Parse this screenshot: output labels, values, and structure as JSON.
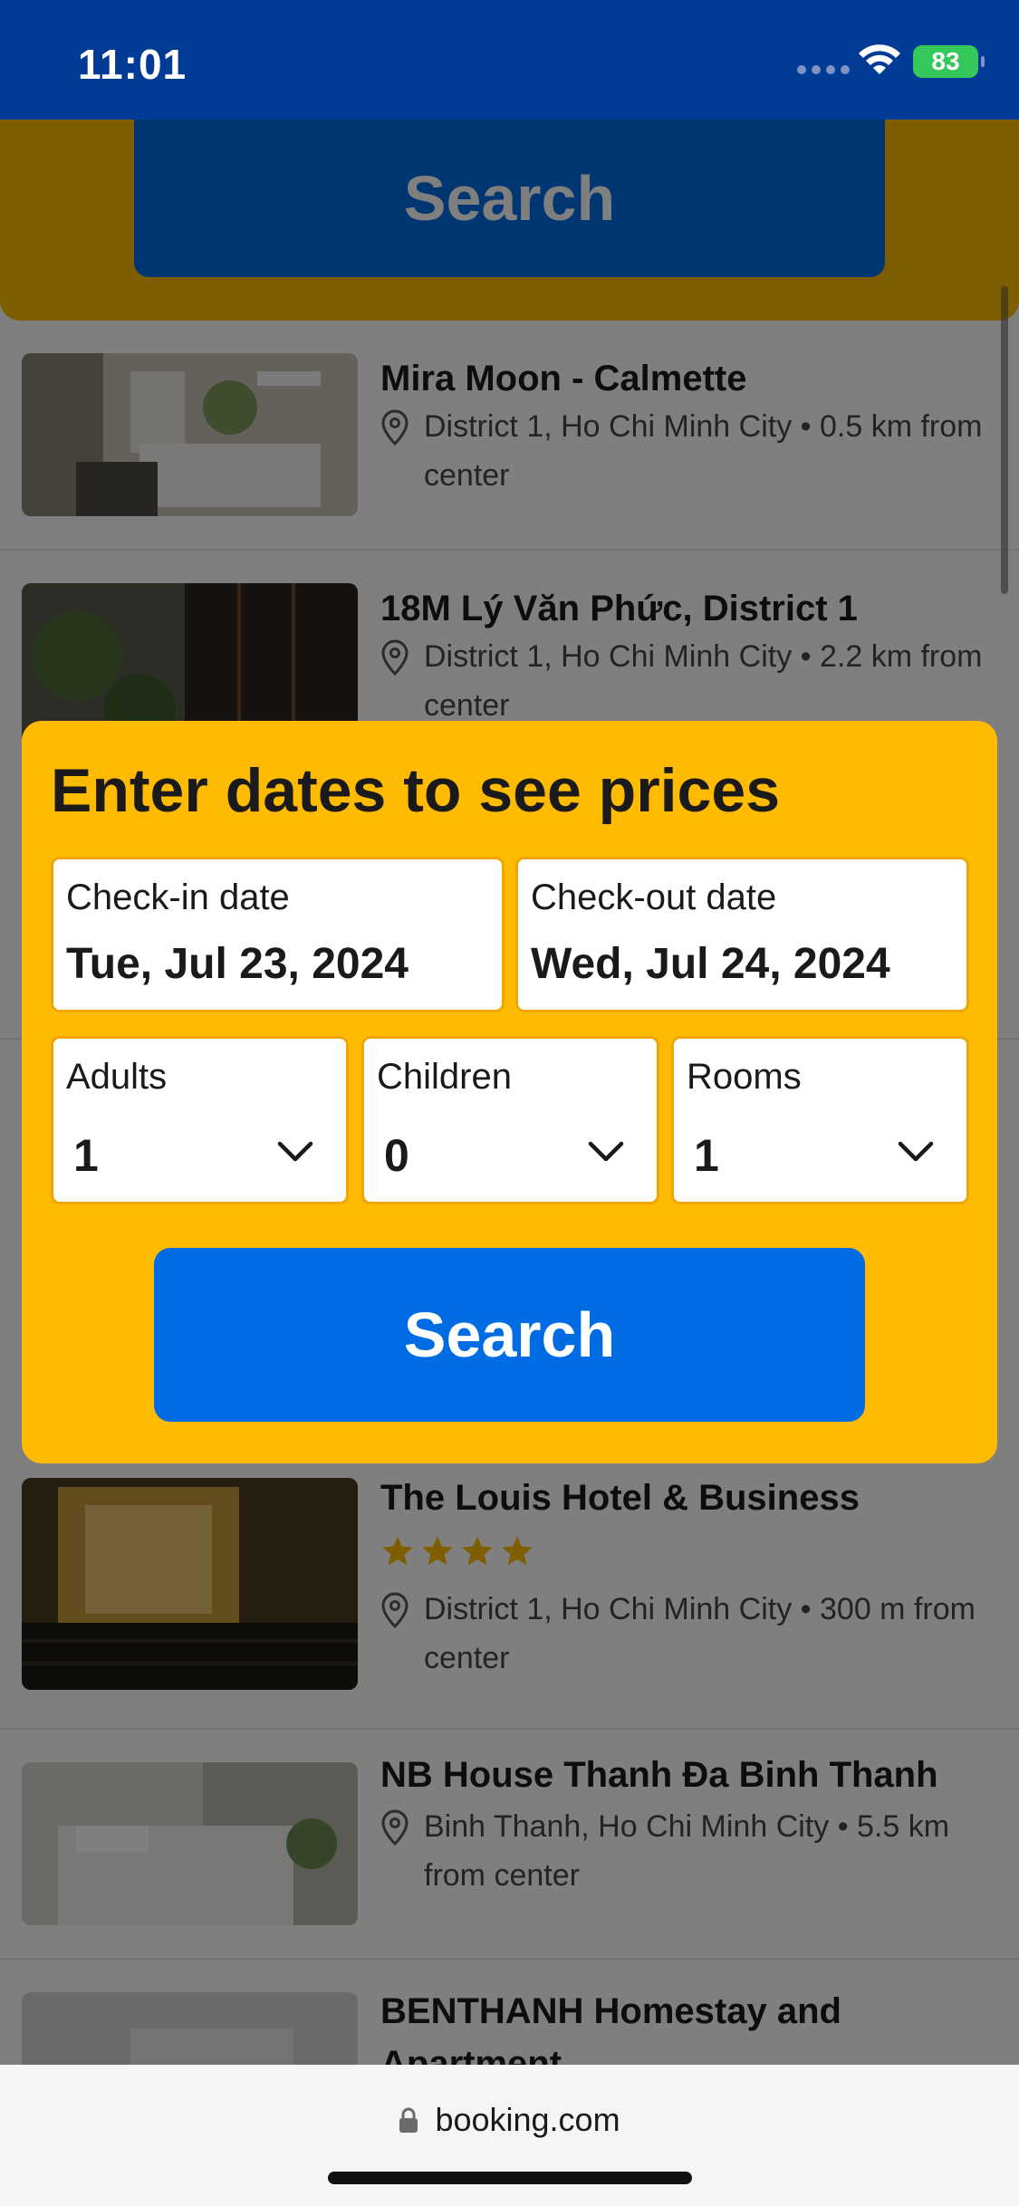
{
  "status_bar": {
    "time": "11:01",
    "battery": "83",
    "icons": [
      "signal-icon",
      "wifi-icon",
      "battery-charging-icon"
    ]
  },
  "header": {
    "search_label": "Search"
  },
  "results": [
    {
      "name": "Mira Moon - Calmette",
      "location": "District 1, Ho Chi Minh City",
      "distance": "0.5 km from center",
      "stars": 0
    },
    {
      "name": "18M Lý Văn Phức, District 1",
      "location": "District 1, Ho Chi Minh City",
      "distance": "2.2 km from center",
      "stars": 0
    },
    {
      "name": "The Louis Hotel & Business",
      "location": "District 1, Ho Chi Minh City",
      "distance": "300 m from center",
      "stars": 4
    },
    {
      "name": "NB House Thanh Đa Binh Thanh",
      "location": "Binh Thanh, Ho Chi Minh City",
      "distance": "5.5 km from center",
      "stars": 0
    },
    {
      "name": "BENTHANH Homestay and Apartment",
      "location": "",
      "distance": "",
      "stars": 0
    }
  ],
  "modal": {
    "title": "Enter dates to see prices",
    "check_in": {
      "label": "Check-in date",
      "value": "Tue, Jul 23, 2024"
    },
    "check_out": {
      "label": "Check-out date",
      "value": "Wed, Jul 24, 2024"
    },
    "adults": {
      "label": "Adults",
      "value": "1"
    },
    "children": {
      "label": "Children",
      "value": "0"
    },
    "rooms": {
      "label": "Rooms",
      "value": "1"
    },
    "search_label": "Search"
  },
  "browser": {
    "url": "booking.com"
  },
  "colors": {
    "brand_blue": "#003b95",
    "action_blue": "#006ce4",
    "accent_yellow": "#febb02",
    "star_yellow": "#febb02"
  }
}
